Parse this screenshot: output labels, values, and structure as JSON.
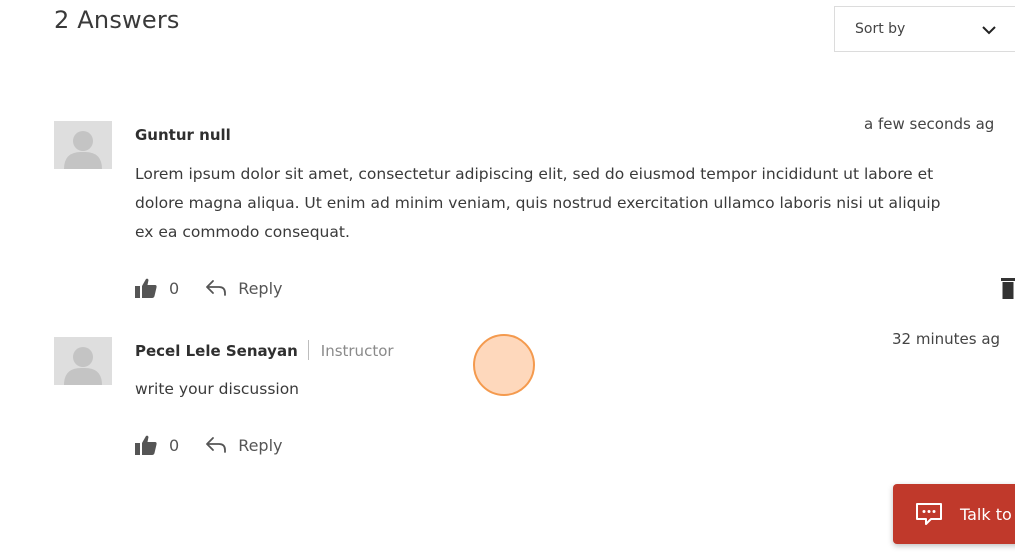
{
  "header": {
    "title": "2 Answers",
    "sort_label": "Sort by"
  },
  "answers": [
    {
      "author": "Guntur null",
      "role": "",
      "time": "a few seconds ag",
      "body_lines": [
        "Lorem ipsum dolor sit amet, consectetur adipiscing elit, sed do eiusmod tempor incididunt ut labore et",
        "dolore magna aliqua. Ut enim ad minim veniam, quis nostrud exercitation ullamco laboris nisi ut aliquip",
        "ex ea commodo consequat."
      ],
      "likes": "0",
      "reply_label": "Reply"
    },
    {
      "author": "Pecel Lele Senayan",
      "role": "Instructor",
      "time": "32 minutes ag",
      "body_lines": [
        "write your discussion"
      ],
      "likes": "0",
      "reply_label": "Reply"
    }
  ],
  "chat": {
    "label": "Talk to"
  },
  "colors": {
    "accent": "#c0392b",
    "cursor_highlight": "#f49a4e"
  }
}
